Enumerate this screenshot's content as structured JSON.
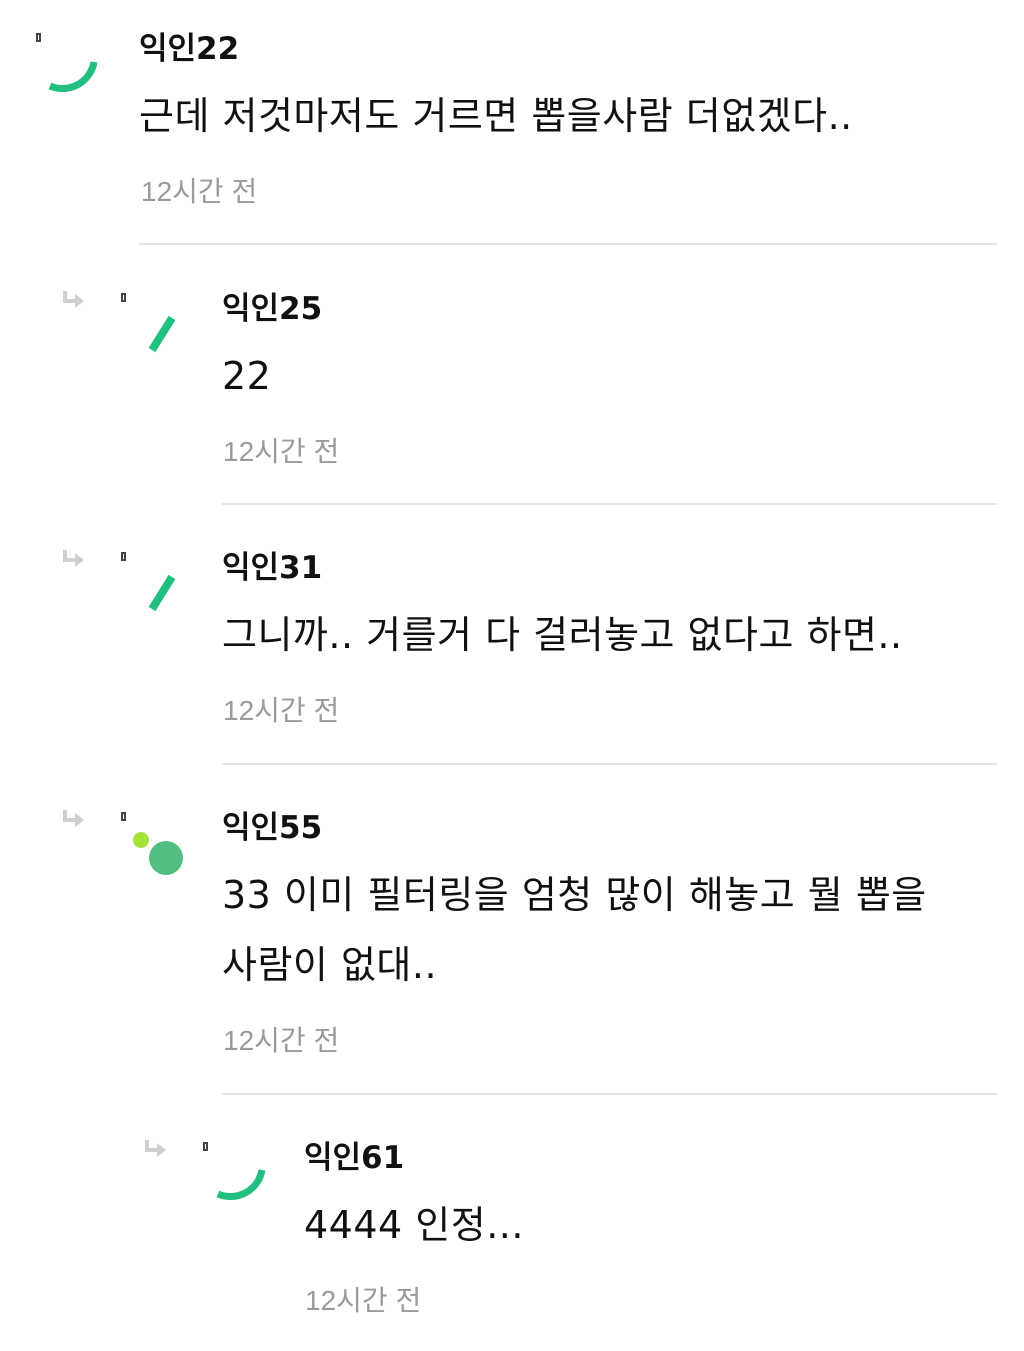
{
  "comments": [
    {
      "nickname": "익인22",
      "text": "근데 저것마저도 거르면 뽑을사람 더없겠다..",
      "time": "12시간 전",
      "is_reply": false,
      "avatar_icon": "spinner-arc-icon",
      "accent_color": "#21c080"
    },
    {
      "nickname": "익인25",
      "text": "22",
      "time": "12시간 전",
      "is_reply": true,
      "avatar_icon": "spinner-dash-icon",
      "accent_color": "#21c080"
    },
    {
      "nickname": "익인31",
      "text": "그니까.. 거를거 다 걸러놓고 없다고 하면..",
      "time": "12시간 전",
      "is_reply": true,
      "avatar_icon": "spinner-dash-icon",
      "accent_color": "#21c080"
    },
    {
      "nickname": "익인55",
      "text": "33 이미 필터링을 엄청 많이 해놓고 뭘 뽑을 사람이 없대..",
      "time": "12시간 전",
      "is_reply": true,
      "avatar_icon": "spinner-dots-icon",
      "accent_color": "#52be80"
    },
    {
      "nickname": "익인61",
      "text": "4444 인정...",
      "time": "12시간 전",
      "is_reply": true,
      "avatar_icon": "spinner-arc-icon",
      "accent_color": "#21c080"
    }
  ]
}
